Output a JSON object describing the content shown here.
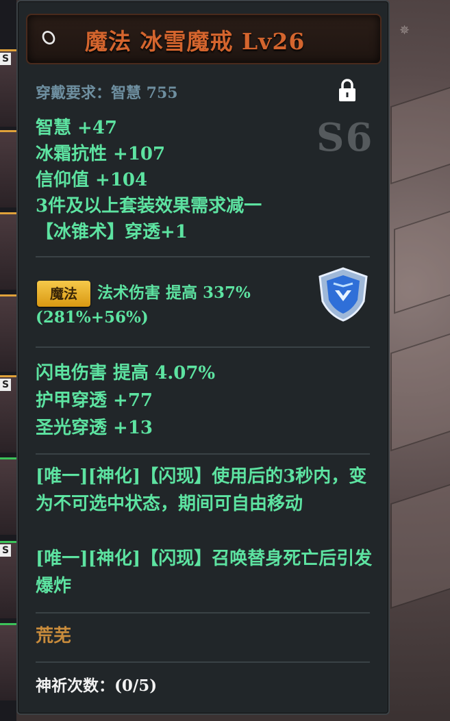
{
  "item": {
    "title": "魔法 冰雪魔戒 Lv26",
    "requirement": "穿戴要求：智慧 755",
    "grade": "S6",
    "stats": [
      "智慧 +47",
      "冰霜抗性 +107",
      "信仰值 +104",
      "3件及以上套装效果需求减一",
      "【冰锥术】穿透+1"
    ],
    "magic_badge": "魔法",
    "magic_line": "法术伤害 提高 337%(281%+56%)",
    "extra_stats": [
      "闪电伤害 提高 4.07%",
      "护甲穿透 +77",
      "圣光穿透 +13"
    ],
    "unique_effects": [
      "[唯一][神化]【闪现】使用后的3秒内，变为不可选中状态，期间可自由移动",
      "[唯一][神化]【闪现】召唤替身死亡后引发爆炸"
    ],
    "set_name": "荒芜",
    "pray_count": "神祈次数：(0/5)"
  },
  "icons": {
    "ring": "ring-icon",
    "lock": "lock-icon",
    "shield": "shield-rank-icon"
  },
  "colors": {
    "title": "#d4652e",
    "stat_green": "#5de3a1",
    "set_gold": "#c98c3c",
    "requirement": "#6e8fa0"
  }
}
